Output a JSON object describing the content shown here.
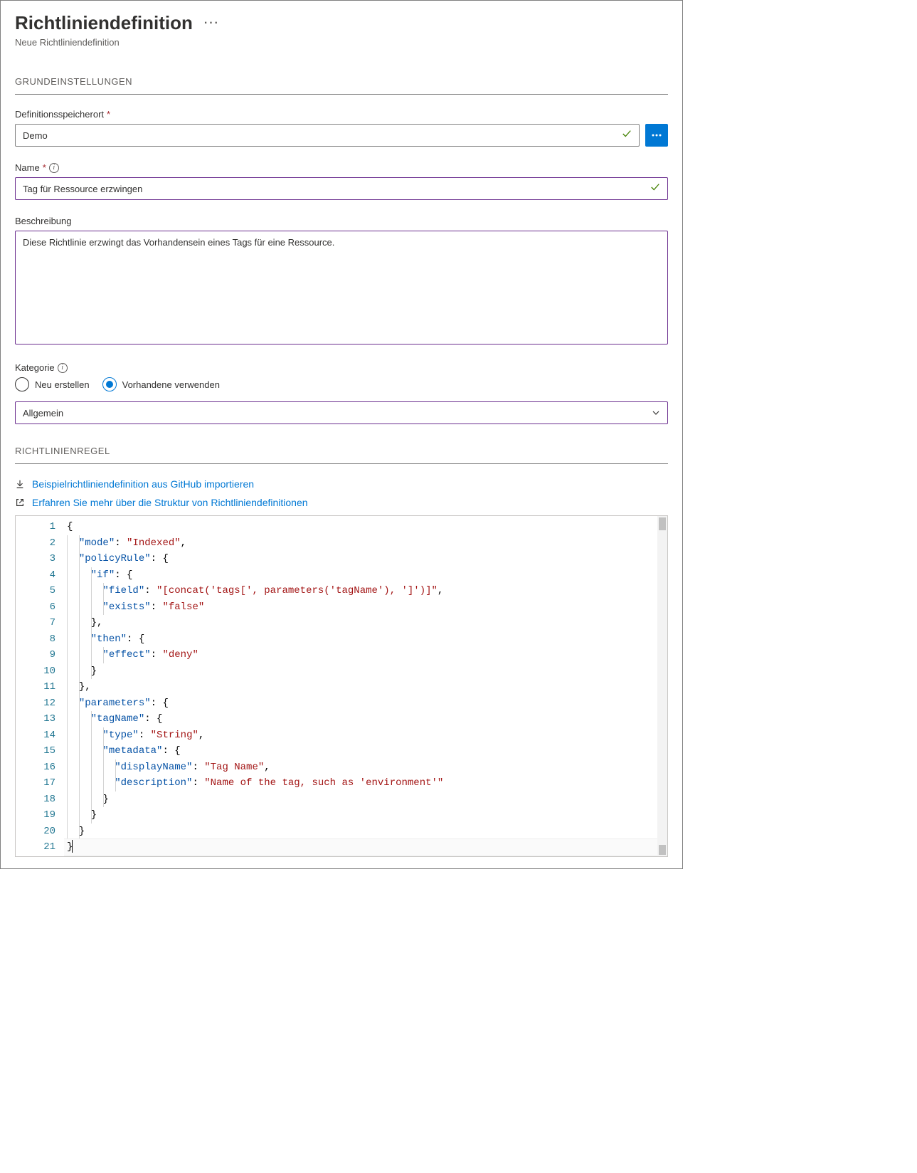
{
  "header": {
    "title": "Richtliniendefinition",
    "subtitle": "Neue Richtliniendefinition"
  },
  "sections": {
    "basics": "GRUNDEINSTELLUNGEN",
    "rule": "RICHTLINIENREGEL"
  },
  "fields": {
    "location": {
      "label": "Definitionsspeicherort",
      "value": "Demo"
    },
    "name": {
      "label": "Name",
      "value": "Tag für Ressource erzwingen"
    },
    "description": {
      "label": "Beschreibung",
      "value": "Diese Richtlinie erzwingt das Vorhandensein eines Tags für eine Ressource."
    },
    "category": {
      "label": "Kategorie",
      "options": {
        "create": "Neu erstellen",
        "existing": "Vorhandene verwenden"
      },
      "selected": "existing",
      "value": "Allgemein"
    }
  },
  "links": {
    "import": "Beispielrichtliniendefinition aus GitHub importieren",
    "learn": "Erfahren Sie mehr über die Struktur von Richtliniendefinitionen"
  },
  "code": {
    "lines": [
      "{",
      "  \"mode\": \"Indexed\",",
      "  \"policyRule\": {",
      "    \"if\": {",
      "      \"field\": \"[concat('tags[', parameters('tagName'), ']')]\",",
      "      \"exists\": \"false\"",
      "    },",
      "    \"then\": {",
      "      \"effect\": \"deny\"",
      "    }",
      "  },",
      "  \"parameters\": {",
      "    \"tagName\": {",
      "      \"type\": \"String\",",
      "      \"metadata\": {",
      "        \"displayName\": \"Tag Name\",",
      "        \"description\": \"Name of the tag, such as 'environment'\"",
      "      }",
      "    }",
      "  }",
      "}"
    ],
    "line_count": 21
  }
}
